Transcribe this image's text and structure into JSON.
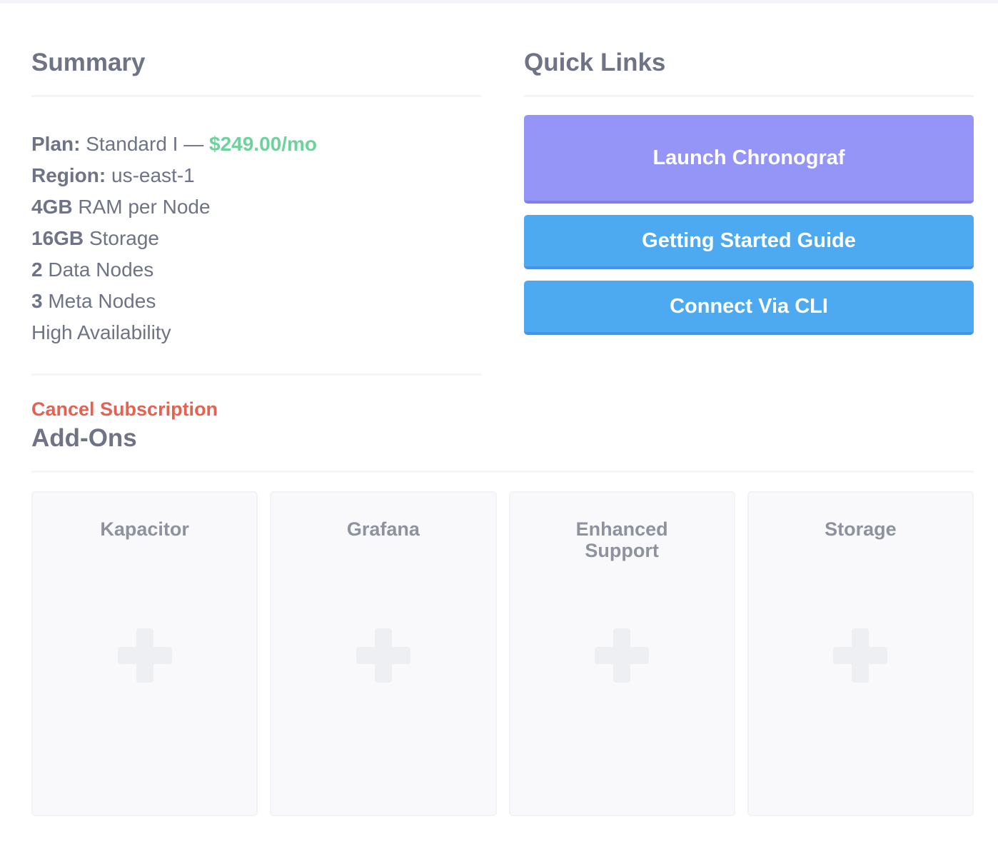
{
  "summary": {
    "title": "Summary",
    "plan_label": "Plan:",
    "plan_value": "Standard I —",
    "plan_price": "$249.00/mo",
    "region_label": "Region:",
    "region_value": "us-east-1",
    "ram_value": "4GB",
    "ram_text": "RAM per Node",
    "storage_value": "16GB",
    "storage_text": "Storage",
    "data_nodes_value": "2",
    "data_nodes_text": "Data Nodes",
    "meta_nodes_value": "3",
    "meta_nodes_text": "Meta Nodes",
    "availability": "High Availability",
    "cancel_label": "Cancel Subscription"
  },
  "quick_links": {
    "title": "Quick Links",
    "launch_label": "Launch Chronograf",
    "guide_label": "Getting Started Guide",
    "cli_label": "Connect Via CLI"
  },
  "addons": {
    "title": "Add-Ons",
    "items": [
      {
        "name": "Kapacitor",
        "icon": "plus-icon"
      },
      {
        "name": "Grafana",
        "icon": "plus-icon"
      },
      {
        "name": "Enhanced Support",
        "icon": "plus-icon"
      },
      {
        "name": "Storage",
        "icon": "plus-icon"
      }
    ]
  },
  "colors": {
    "heading": "#6e7486",
    "price": "#6ed29c",
    "cancel": "#e4624f",
    "launch_button": "#9595f7",
    "link_button": "#4eaaf0"
  }
}
